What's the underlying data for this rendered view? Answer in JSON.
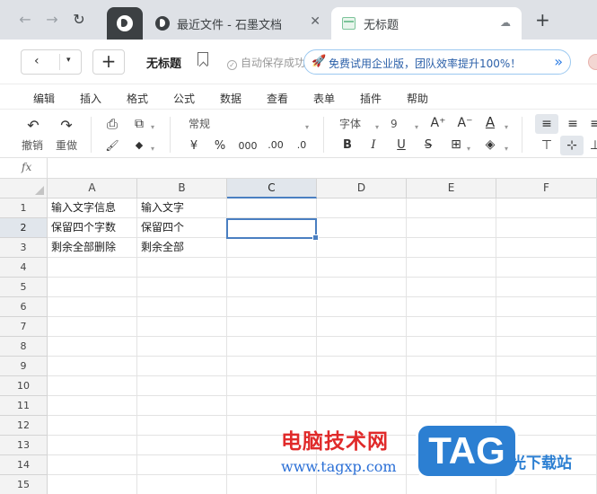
{
  "browser": {
    "tabs": [
      {
        "title": "最近文件 - 石墨文档",
        "close": "✕"
      },
      {
        "title": "无标题",
        "status_icon": "☁"
      }
    ],
    "new_tab": "+",
    "back": "←",
    "forward": "→",
    "reload": "↻"
  },
  "header": {
    "back": "‹",
    "dropdown": "▾",
    "add": "+",
    "title": "无标题",
    "save_status": "自动保存成功",
    "promo": "免费试用企业版，团队效率提升100%！",
    "promo_arrow": "»"
  },
  "menu": [
    "编辑",
    "插入",
    "格式",
    "公式",
    "数据",
    "查看",
    "表单",
    "插件",
    "帮助"
  ],
  "toolbar": {
    "undo_icon": "↶",
    "undo": "撤销",
    "redo_icon": "↷",
    "redo": "重做",
    "print_icon": "⎙",
    "paste_icon": "⧉",
    "format_painter_icon": "🖌",
    "clear_icon": "◆",
    "number_format": "常规",
    "currency": "¥",
    "percent": "%",
    "thousands": "000",
    "dec_decrease": ".00",
    "dec_increase": ".0",
    "font": "字体",
    "font_size": "9",
    "font_grow": "A⁺",
    "font_shrink": "A⁻",
    "font_color": "A",
    "bold": "B",
    "italic": "I",
    "underline": "U",
    "strike": "S",
    "borders": "⊞",
    "fill": "◈",
    "align_left": "≡",
    "align_center": "≡",
    "align_right": "≡",
    "valign_top": "⊤",
    "valign_middle": "⊹",
    "valign_bottom": "⊥"
  },
  "formula_bar": {
    "fx": "fx"
  },
  "sheet": {
    "columns": [
      "A",
      "B",
      "C",
      "D",
      "E",
      "F"
    ],
    "rows": [
      "1",
      "2",
      "3",
      "4",
      "5",
      "6",
      "7",
      "8",
      "9",
      "10",
      "11",
      "12",
      "13",
      "14",
      "15"
    ],
    "cells": [
      [
        "输入文字信息",
        "输入文字"
      ],
      [
        "保留四个字数",
        "保留四个"
      ],
      [
        "剩余全部删除",
        "剩余全部"
      ]
    ],
    "selected_cell": "C2"
  },
  "watermark": {
    "cn": "电脑技术网",
    "url": "www.tagxp.com",
    "tag": "TAG",
    "sub": "光下载站"
  },
  "colors": {
    "selection": "#4a7fc1",
    "accent_blue": "#2a7be4",
    "watermark_red": "#e02a2a"
  }
}
